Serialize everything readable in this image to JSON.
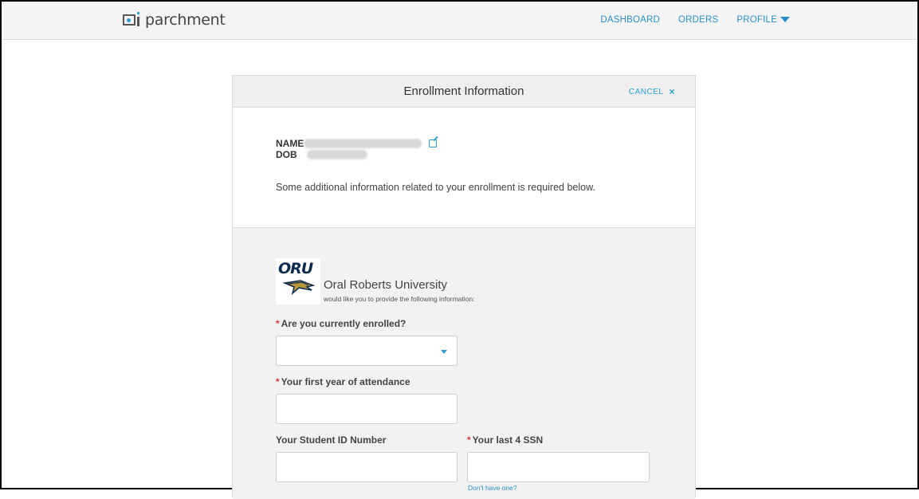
{
  "nav": {
    "logo_text": "parchment",
    "dashboard": "DASHBOARD",
    "orders": "ORDERS",
    "profile": "PROFILE"
  },
  "modal": {
    "title": "Enrollment Information",
    "cancel": "CANCEL",
    "cancel_icon": "×",
    "name_label": "NAME",
    "dob_label": "DOB",
    "note": "Some additional information related to your enrollment is required below."
  },
  "institution": {
    "logo_text": "ORU",
    "name": "Oral Roberts University",
    "subtitle": "would like you to provide the following information:"
  },
  "form": {
    "required_marker": "*",
    "enrolled_label": "Are you currently enrolled?",
    "enrolled_value": "",
    "first_year_label": "Your first year of attendance",
    "first_year_value": "",
    "student_id_label": "Your Student ID Number",
    "student_id_value": "",
    "ssn_label": "Your last 4 SSN",
    "ssn_value": "",
    "no_ssn_link": "Don't have one?"
  },
  "colors": {
    "accent": "#2a9fd6",
    "required": "#d9363e",
    "brand_navy": "#0d2a4f"
  }
}
